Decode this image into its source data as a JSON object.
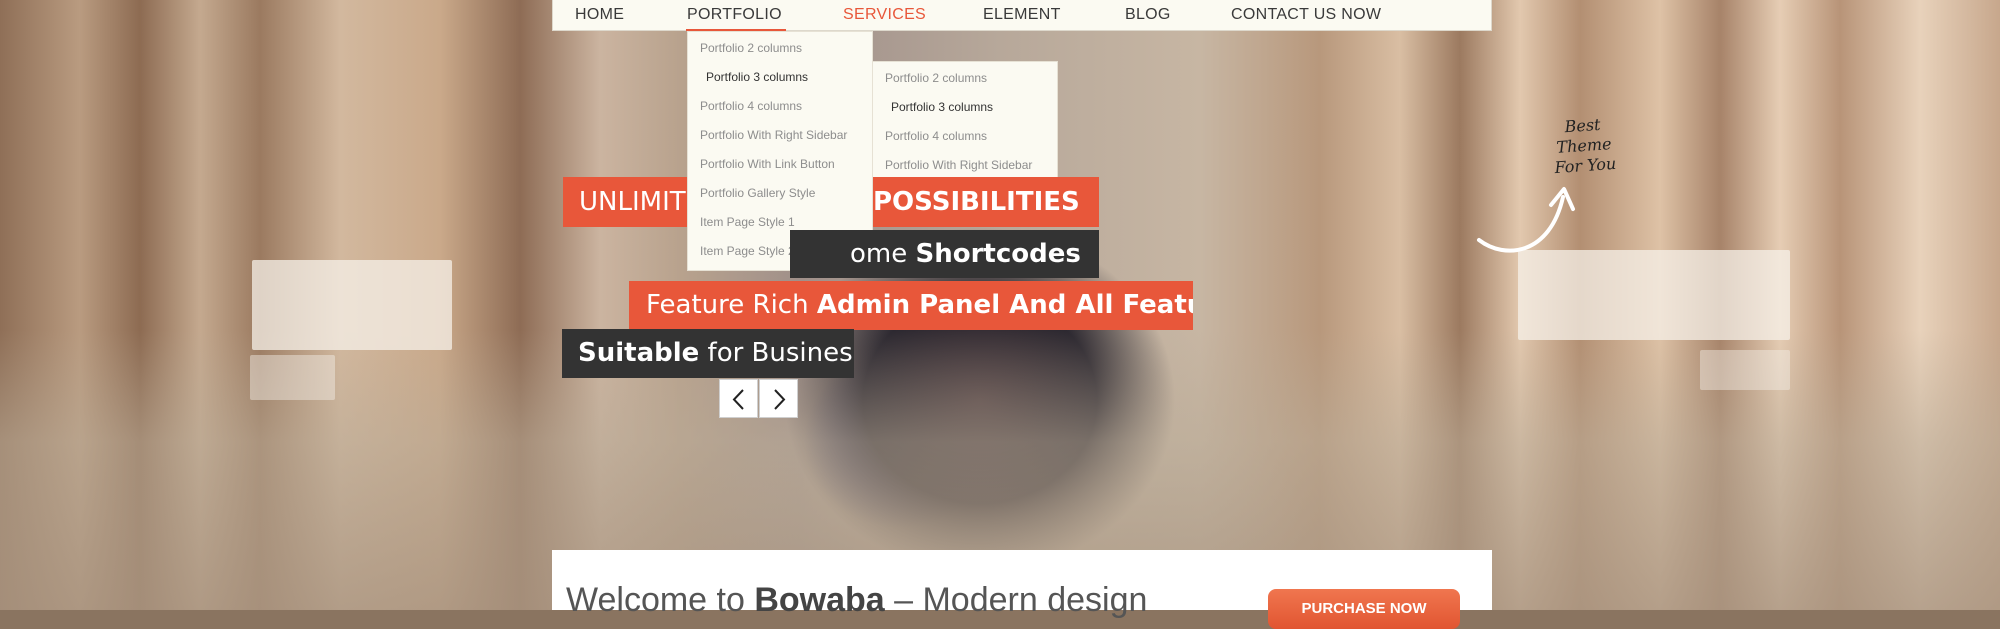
{
  "nav": {
    "items": [
      {
        "label": "HOME"
      },
      {
        "label": "PORTFOLIO"
      },
      {
        "label": "SERVICES"
      },
      {
        "label": "ELEMENT"
      },
      {
        "label": "BLOG"
      },
      {
        "label": "CONTACT US NOW"
      }
    ],
    "active_color": "#e8573a"
  },
  "portfolio_menu": {
    "items": [
      {
        "label": "Portfolio 2 columns"
      },
      {
        "label": "Portfolio 3 columns"
      },
      {
        "label": "Portfolio 4 columns"
      },
      {
        "label": "Portfolio With Right Sidebar"
      },
      {
        "label": "Portfolio With Link Button"
      },
      {
        "label": "Portfolio Gallery Style"
      },
      {
        "label": "Item Page Style 1"
      },
      {
        "label": "Item Page Style 2"
      }
    ]
  },
  "portfolio_submenu": {
    "items": [
      {
        "label": "Portfolio 2 columns"
      },
      {
        "label": "Portfolio 3 columns"
      },
      {
        "label": "Portfolio 4 columns"
      },
      {
        "label": "Portfolio With Right Sidebar"
      }
    ]
  },
  "slider": {
    "caption1": {
      "left": "UNLIMIT",
      "right": "POSSIBILITIES"
    },
    "caption2": {
      "normal": "ome ",
      "bold": "Shortcodes"
    },
    "caption3": {
      "normal": "Feature Rich ",
      "bold": "Admin Panel And All Features"
    },
    "caption4": {
      "bold": "Suitable",
      "normal": " for Business"
    },
    "prev_icon": "chevron-left-icon",
    "next_icon": "chevron-right-icon"
  },
  "badge": {
    "line1": "Best",
    "line2": "Theme",
    "line3": "For You"
  },
  "welcome": {
    "prefix": "Welcome to ",
    "brand": "Bowaba",
    "suffix": " – Modern design",
    "button_label": "PURCHASE NOW"
  },
  "colors": {
    "accent": "#e8573a",
    "dark": "#333333",
    "nav_bg": "#fbfaf2"
  }
}
